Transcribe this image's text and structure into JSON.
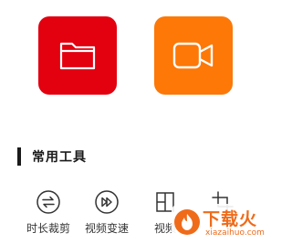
{
  "tiles": [
    {
      "icon": "folder-icon",
      "color": "#e3000f"
    },
    {
      "icon": "video-camera-icon",
      "color": "#fd7807"
    }
  ],
  "section": {
    "title": "常用工具"
  },
  "tools": [
    {
      "label": "时长裁剪",
      "icon": "swap-arrows-icon"
    },
    {
      "label": "视频变速",
      "icon": "fast-forward-icon"
    },
    {
      "label": "视频",
      "icon": "split-frame-icon"
    },
    {
      "label": "",
      "icon": "crop-icon"
    }
  ],
  "watermark": {
    "main": "下载火",
    "sub": "xiazaihuo.com",
    "color": "#ef6b1a"
  }
}
